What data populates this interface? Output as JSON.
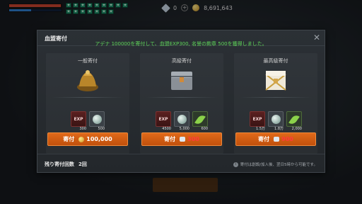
{
  "hud": {
    "buff_glyphs": [
      "✦",
      "✦",
      "✦",
      "✦",
      "✦",
      "✦",
      "✦",
      "✦",
      "✦",
      "✦",
      "✦",
      "✦",
      "✦",
      "✦",
      "✦",
      "✦"
    ],
    "gem_count": "0",
    "adena": "8,691,643",
    "hp_fraction": 0.98,
    "mp_fraction": 0.42
  },
  "modal": {
    "title": "血盟寄付",
    "notice": "アデナ 100000を寄付して、血盟EXP300, 名誉の勲章 500を獲得しました。",
    "tiers": [
      {
        "name": "一般寄付",
        "rewards": [
          {
            "icon": "exp-icon",
            "label": "EXP",
            "qty": "300"
          },
          {
            "icon": "honor-medal-icon",
            "qty": "500"
          }
        ],
        "button_label": "寄付",
        "cost": "100,000",
        "cost_currency": "adena-coin-icon"
      },
      {
        "name": "高級寄付",
        "rewards": [
          {
            "icon": "exp-icon",
            "label": "EXP",
            "qty": "4500"
          },
          {
            "icon": "honor-medal-icon",
            "qty": "5,000"
          },
          {
            "icon": "leaf-icon",
            "qty": "600"
          }
        ],
        "button_label": "寄付",
        "cost": "300",
        "cost_currency": "red-diamond-icon"
      },
      {
        "name": "最高級寄付",
        "rewards": [
          {
            "icon": "exp-icon",
            "label": "EXP",
            "qty": "1.5万"
          },
          {
            "icon": "honor-medal-icon",
            "qty": "1.8万"
          },
          {
            "icon": "leaf-icon",
            "qty": "2,000"
          }
        ],
        "button_label": "寄付",
        "cost": "900",
        "cost_currency": "red-diamond-icon"
      }
    ],
    "remaining_label": "残り寄付回数",
    "remaining_count": "2回",
    "info_text": "寄付は創設/加入後、翌日5時から可能です。"
  },
  "colors": {
    "accent_orange": "#d45e12",
    "notice_green": "#5fd65a",
    "cost_red": "#ff3a3a"
  }
}
